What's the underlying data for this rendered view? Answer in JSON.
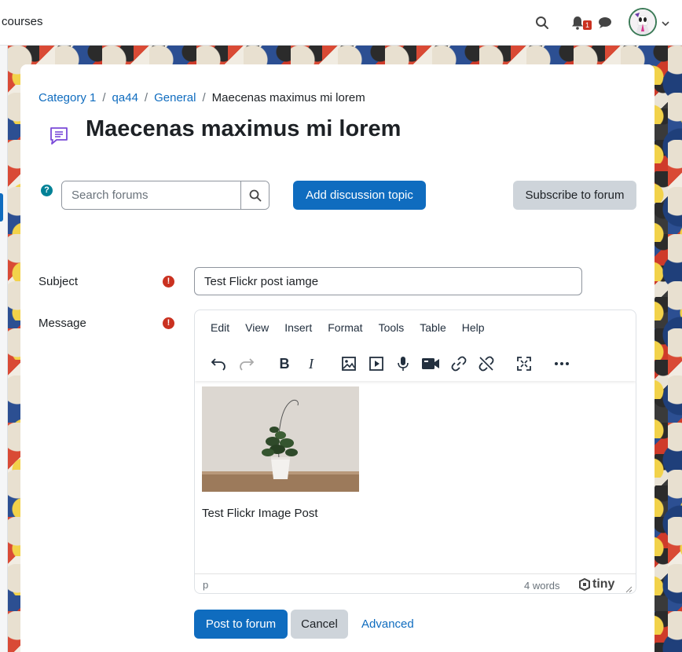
{
  "navbar": {
    "courses_label": "courses",
    "notification_count": "1"
  },
  "breadcrumb": {
    "items": [
      "Category 1",
      "qa44",
      "General"
    ],
    "current": "Maecenas maximus mi lorem"
  },
  "page": {
    "title": "Maecenas maximus mi lorem"
  },
  "search": {
    "placeholder": "Search forums"
  },
  "actions": {
    "add_discussion": "Add discussion topic",
    "subscribe": "Subscribe to forum"
  },
  "form": {
    "subject_label": "Subject",
    "subject_value": "Test Flickr post iamge",
    "message_label": "Message",
    "required_glyph": "!"
  },
  "editor": {
    "menu": [
      "Edit",
      "View",
      "Insert",
      "Format",
      "Tools",
      "Table",
      "Help"
    ],
    "body_text": "Test Flickr Image Post",
    "status_path": "p",
    "word_count": "4 words",
    "brand": "tiny"
  },
  "footer": {
    "post": "Post to forum",
    "cancel": "Cancel",
    "advanced": "Advanced"
  },
  "colors": {
    "primary": "#0f6cbf",
    "secondary": "#ced4da",
    "required": "#ca3120",
    "help": "#008196"
  }
}
